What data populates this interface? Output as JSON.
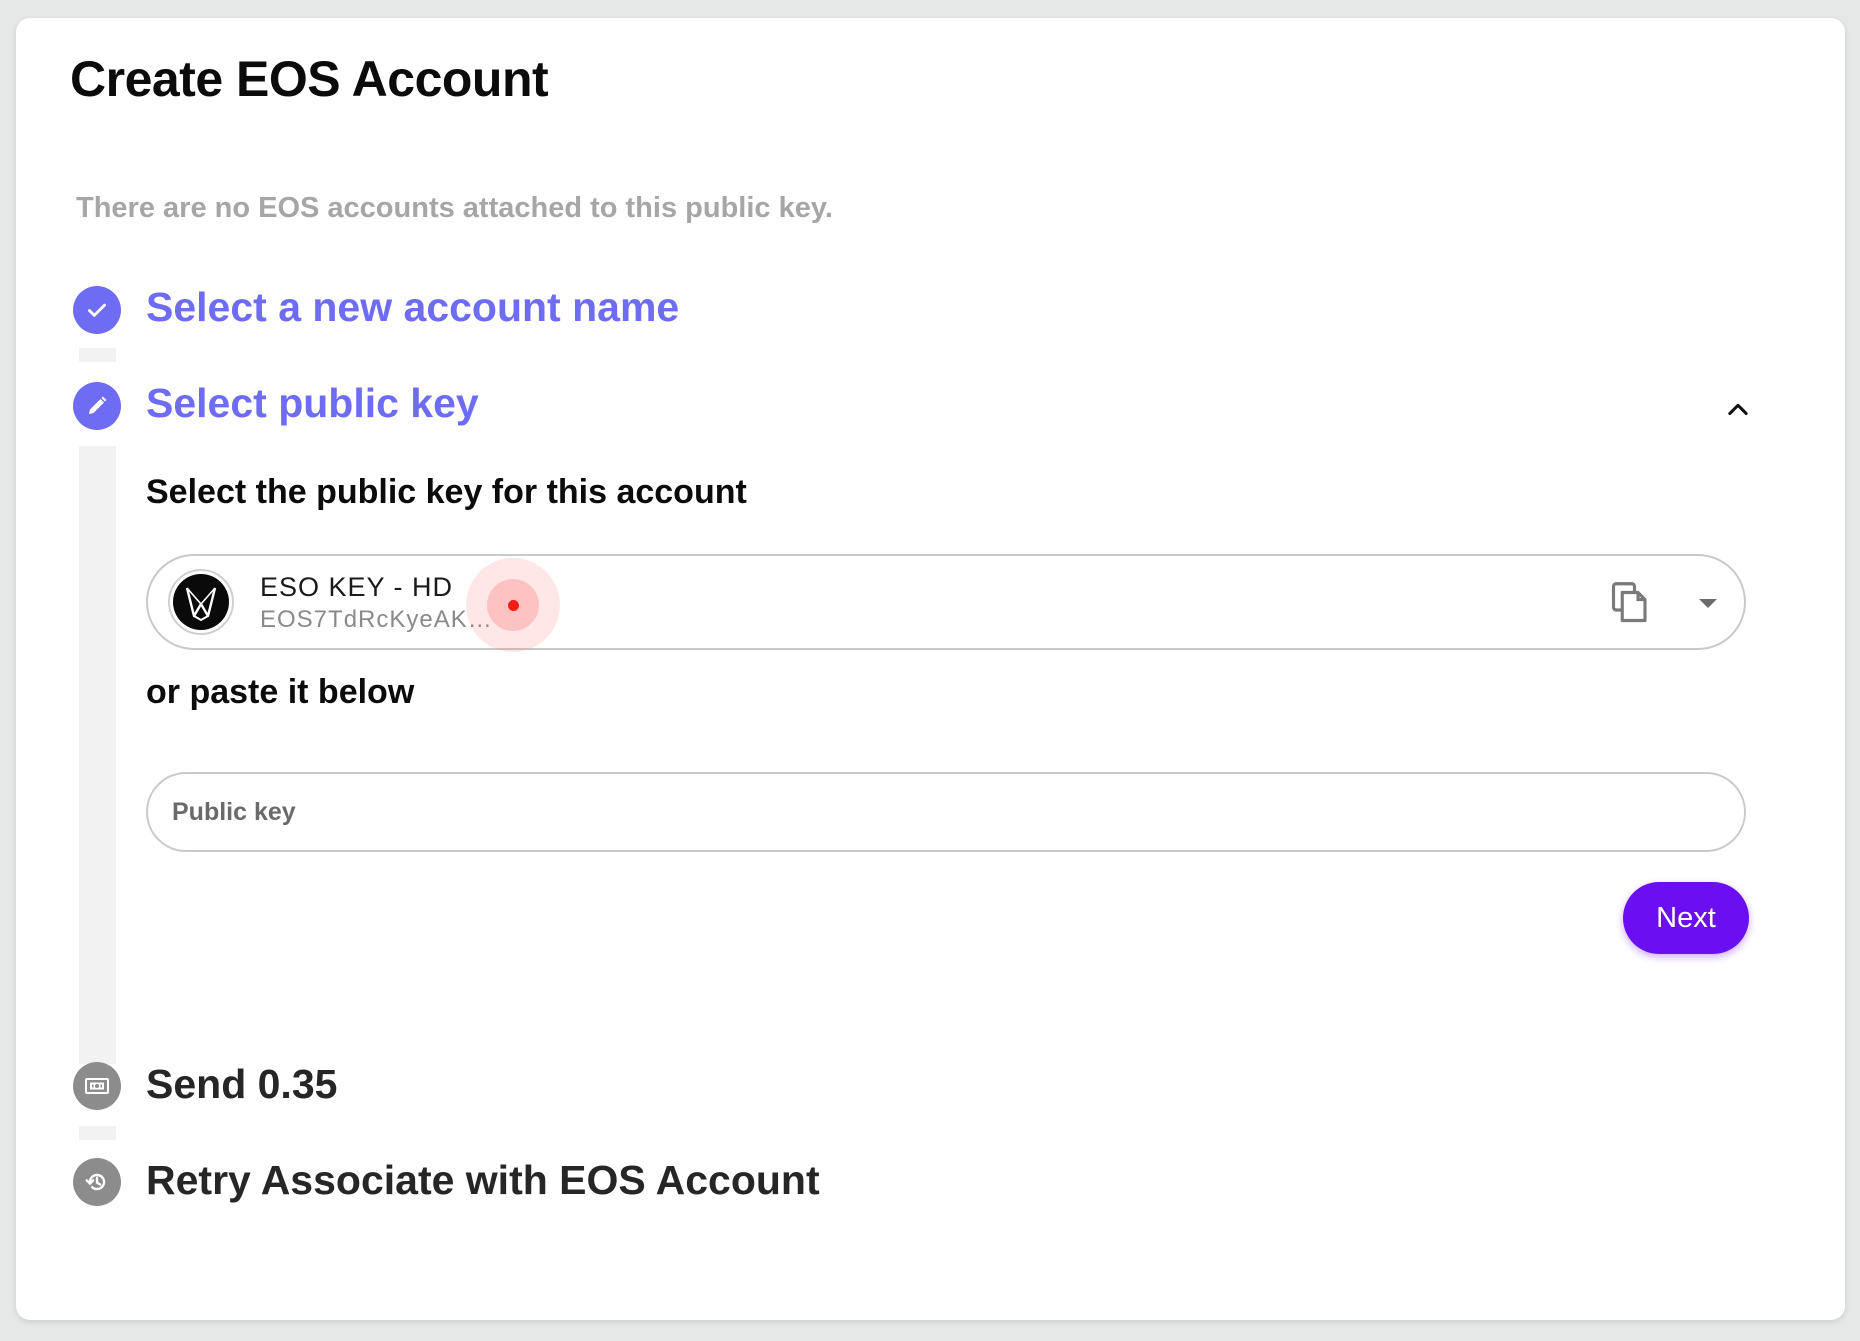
{
  "page": {
    "title": "Create EOS Account",
    "subtitle": "There are no EOS accounts attached to this public key."
  },
  "steps": [
    {
      "label": "Select a new account name",
      "state": "completed",
      "icon": "check-icon"
    },
    {
      "label": "Select public key",
      "state": "active",
      "icon": "pencil-icon"
    },
    {
      "label": "Send 0.35",
      "state": "pending",
      "icon": "cash-icon"
    },
    {
      "label": "Retry Associate with EOS Account",
      "state": "pending",
      "icon": "history-icon"
    }
  ],
  "public_key_step": {
    "heading": "Select the public key for this account",
    "selected_key": {
      "name": "ESO KEY - HD",
      "value": "EOS7TdRcKyeAKp..."
    },
    "paste_heading": "or paste it below",
    "input": {
      "placeholder": "Public key",
      "value": ""
    },
    "next_label": "Next"
  },
  "colors": {
    "accent": "#6e6cf3",
    "button": "#6a0ff0",
    "pending": "#8c8c8c",
    "muted_text": "#a6a6a6"
  }
}
